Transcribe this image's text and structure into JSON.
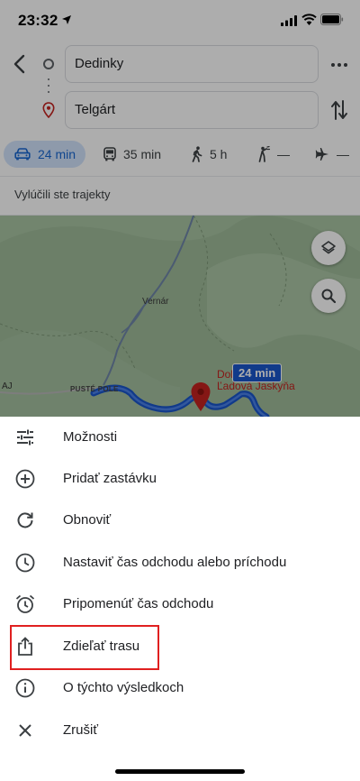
{
  "status_bar": {
    "time": "23:32"
  },
  "directions": {
    "origin": "Dedinky",
    "destination": "Telgárt"
  },
  "modes": [
    {
      "name": "drive",
      "label": "24 min",
      "selected": true
    },
    {
      "name": "transit",
      "label": "35 min"
    },
    {
      "name": "walk",
      "label": "5 h"
    },
    {
      "name": "ride",
      "label": "—"
    },
    {
      "name": "flight",
      "label": "—"
    }
  ],
  "route_note": "Vylúčili ste trajekty",
  "map": {
    "places": {
      "vernar": "Vernár",
      "puste_pole": "PUSTÉ POLE",
      "aj": "AJ"
    },
    "destination_label_line1": "Dobšinská",
    "destination_label_line2": "Ľadová Jaskyňa",
    "route_duration": "24 min",
    "route_color": "#1a56cc"
  },
  "menu": [
    {
      "name": "options",
      "icon": "tune-sliders-icon",
      "label": "Možnosti"
    },
    {
      "name": "add-stop",
      "icon": "add-circle-icon",
      "label": "Pridať zastávku"
    },
    {
      "name": "refresh",
      "icon": "refresh-icon",
      "label": "Obnoviť"
    },
    {
      "name": "set-time",
      "icon": "clock-icon",
      "label": "Nastaviť čas odchodu alebo príchodu"
    },
    {
      "name": "remind",
      "icon": "alarm-clock-icon",
      "label": "Pripomenúť čas odchodu"
    },
    {
      "name": "share",
      "icon": "share-icon",
      "label": "Zdieľať trasu",
      "highlighted": true
    },
    {
      "name": "about",
      "icon": "info-icon",
      "label": "O týchto výsledkoch"
    },
    {
      "name": "cancel",
      "icon": "close-icon",
      "label": "Zrušiť"
    }
  ],
  "colors": {
    "highlight": "#e02020",
    "accent": "#1967d2",
    "pin": "#c5221f"
  }
}
